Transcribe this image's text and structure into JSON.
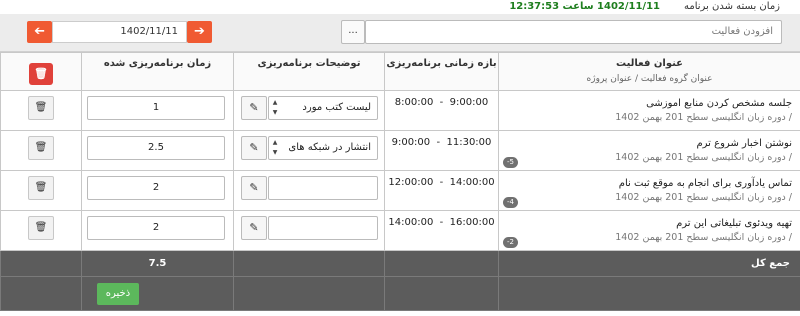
{
  "header": {
    "close_label": "زمان بسته شدن برنامه",
    "close_time": "1402/11/11 ساعت 12:37:53"
  },
  "toolbar": {
    "activity_placeholder": "افزودن فعالیت",
    "browse_label": "...",
    "date_value": "1402/11/11",
    "prev_icon": "arrow-left-icon",
    "next_icon": "arrow-right-icon"
  },
  "columns": {
    "activity_title": "عنوان فعالیت",
    "activity_sub": "عنوان گروه فعالیت / عنوان پروژه",
    "range": "بازه زمانی برنامه‌ریزی",
    "description": "توضیحات برنامه‌ریزی",
    "duration": "زمان برنامه‌ریزی شده"
  },
  "rows": [
    {
      "title": "جلسه مشخص کردن منابع اموزشی",
      "sub": "/ دوره زبان انگلیسی سطح 201 بهمن 1402",
      "badge": "",
      "start": "8:00:00",
      "end": "9:00:00",
      "description": "لیست کتب مورد",
      "duration": "1"
    },
    {
      "title": "نوشتن اخبار شروع ترم",
      "sub": "/ دوره زبان انگلیسی سطح 201 بهمن 1402",
      "badge": "-5",
      "start": "9:00:00",
      "end": "11:30:00",
      "description": "انتشار در شبکه های",
      "duration": "2.5"
    },
    {
      "title": "تماس یادآوری برای انجام به موقع ثبت نام",
      "sub": "/ دوره زبان انگلیسی سطح 201 بهمن 1402",
      "badge": "-4",
      "start": "12:00:00",
      "end": "14:00:00",
      "description": "",
      "duration": "2"
    },
    {
      "title": "تهیه ویدئوی تبلیغاتی این ترم",
      "sub": "/ دوره زبان انگلیسی سطح 201 بهمن 1402",
      "badge": "-2",
      "start": "14:00:00",
      "end": "16:00:00",
      "description": "",
      "duration": "2"
    }
  ],
  "total": {
    "label": "جمع کل",
    "value": "7.5"
  },
  "save_label": "ذخیره",
  "colors": {
    "accent": "#f05a32",
    "delete": "#e0413a",
    "save": "#5cb85c",
    "time_green": "#1e7e1e",
    "footer": "#5c5c5c"
  }
}
